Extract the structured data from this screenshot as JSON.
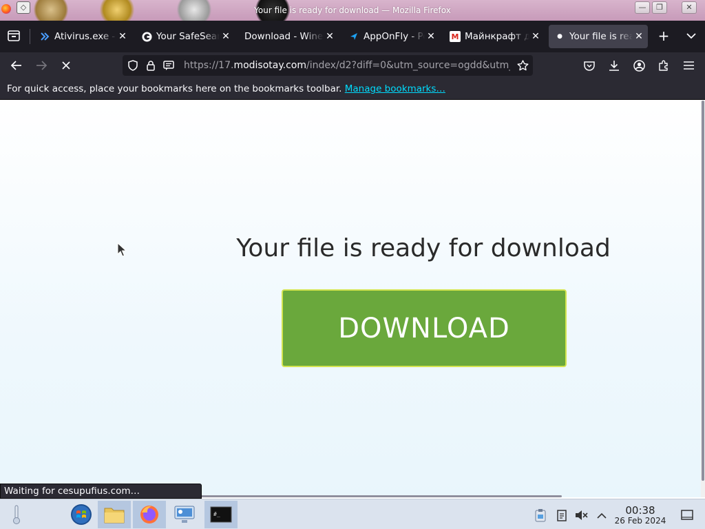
{
  "window": {
    "title": "Your file is ready for download — Mozilla Firefox"
  },
  "tabs": [
    {
      "label": "Ativirus.exe - ",
      "favicon": "chevrons-icon",
      "favicon_color": "#4a9eff",
      "active": false
    },
    {
      "label": "Your SafeSear",
      "favicon": "google-icon",
      "favicon_color": "#4285f4",
      "active": false
    },
    {
      "label": "Download - Wine",
      "favicon": "none",
      "favicon_color": "",
      "active": false
    },
    {
      "label": "AppOnFly - Po",
      "favicon": "send-icon",
      "favicon_color": "#1da1f2",
      "active": false
    },
    {
      "label": "Майнкрафт д",
      "favicon": "m-icon",
      "favicon_color": "#d9261c",
      "active": false
    },
    {
      "label": "Your file is rea",
      "favicon": "loading-dot-icon",
      "favicon_color": "#fbfbfe",
      "active": true
    }
  ],
  "nav": {
    "url_prefix": "https://17.",
    "url_domain": "modisotay.com",
    "url_path": "/index/d2?diff=0&utm_source=ogdd&utm_"
  },
  "bookmarks_bar": {
    "text": "For quick access, place your bookmarks here on the bookmarks toolbar.",
    "link": "Manage bookmarks…"
  },
  "page": {
    "heading": "Your file is ready for download",
    "download_label": "DOWNLOAD",
    "download_color": "#6aa83c"
  },
  "status_panel": "Waiting for cesupufius.com…",
  "taskbar": {
    "time": "00:38",
    "date": "26 Feb 2024"
  }
}
